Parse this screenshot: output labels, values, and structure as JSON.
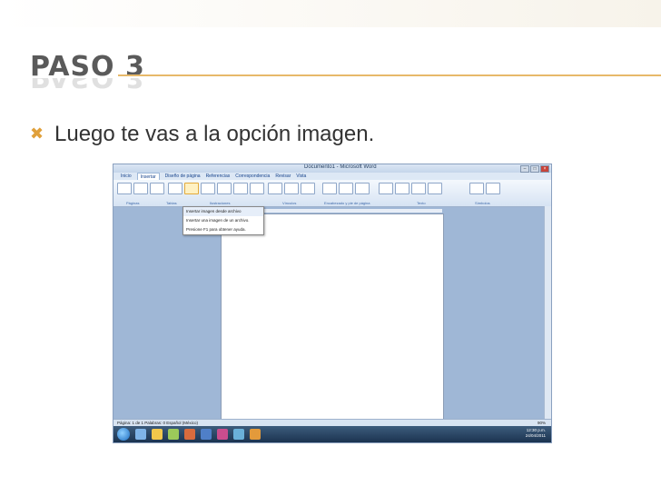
{
  "slide": {
    "title": "PASO 3",
    "bullet": "Luego te vas a la opción imagen."
  },
  "colors": {
    "accent": "#e7b96a",
    "title_text": "#5a5a5a",
    "bullet_icon": "#e0a03a"
  },
  "word": {
    "window_title": "Documento1 - Microsoft Word",
    "tabs": [
      "Inicio",
      "Insertar",
      "Diseño de página",
      "Referencias",
      "Correspondencia",
      "Revisar",
      "Vista"
    ],
    "active_tab": "Insertar",
    "ribbon_groups": [
      "Páginas",
      "Tablas",
      "Ilustraciones",
      "Vínculos",
      "Encabezado y pie de página",
      "Texto",
      "Símbolos"
    ],
    "menu_items": [
      "Insertar imagen desde archivo",
      "Insertar una imagen de un archivo.",
      "Presione F1 para obtener ayuda."
    ],
    "status_left": "Página: 1 de 1   Palabras: 0   Español (México)",
    "zoom": "90%",
    "clock_time": "12:30 p.m.",
    "clock_date": "24/04/2011"
  }
}
